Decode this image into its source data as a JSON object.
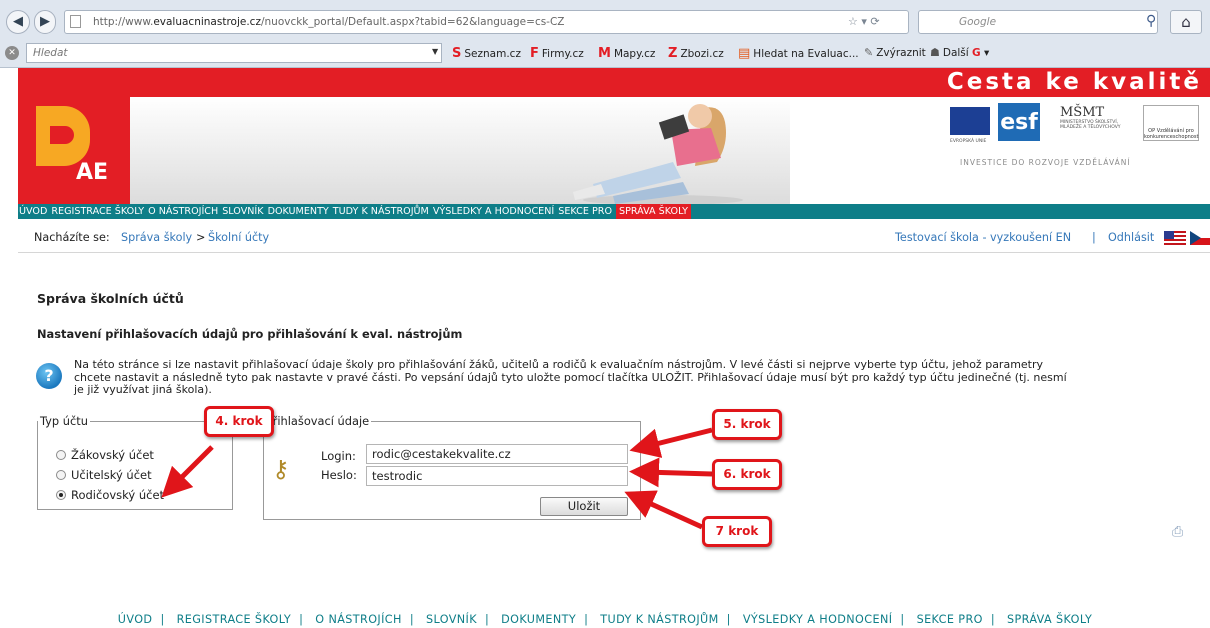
{
  "browser": {
    "url_prefix": "http://www.",
    "url_host": "evaluacninastroje.cz",
    "url_path": "/nuovckk_portal/Default.aspx?tabid=62&language=cs-CZ",
    "search_placeholder": "Google",
    "toolbar_search_placeholder": "Hledat",
    "bookmarks": [
      "Seznam.cz",
      "Firmy.cz",
      "Mapy.cz",
      "Zbozi.cz",
      "Hledat na Evaluac...",
      "Zvýraznit",
      "Další"
    ]
  },
  "banner": {
    "brand_title": "Cesta ke kvalitě",
    "logo_text": "AE",
    "slogan": "INVESTICE DO ROZVOJE VZDĚLÁVÁNÍ",
    "partner_logos": {
      "eu_caption": "EVROPSKÁ UNIE",
      "esf_text": "esf",
      "msmt_text": "MŠMT",
      "msmt_caption": "MINISTERSTVO ŠKOLSTVÍ, MLÁDEŽE A TĚLOVÝCHOVY",
      "op_caption": "OP Vzdělávání pro konkurenceschopnost"
    }
  },
  "menu": {
    "items": [
      "ÚVOD",
      "REGISTRACE ŠKOLY",
      "O NÁSTROJÍCH",
      "SLOVNÍK",
      "DOKUMENTY",
      "TUDY K NÁSTROJŮM",
      "VÝSLEDKY A HODNOCENÍ",
      "SEKCE PRO"
    ],
    "active": "SPRÁVA ŠKOLY"
  },
  "breadcrumb": {
    "label": "Nacházíte se:",
    "items": [
      "Správa školy",
      "Školní účty"
    ],
    "separator": ">"
  },
  "user": {
    "school": "Testovací škola - vyzkoušení EN",
    "separator": "|",
    "logout": "Odhlásit"
  },
  "content": {
    "title": "Správa školních účtů",
    "subtitle": "Nastavení přihlašovacích údajů pro přihlašování k eval. nástrojům",
    "info_line1": "Na této stránce si lze nastavit přihlašovací údaje školy pro přihlašování žáků, učitelů a rodičů k evaluačním nástrojům. V levé části si nejprve vyberte typ účtu, jehož parametry",
    "info_line2": "chcete nastavit a následně tyto pak nastavte v pravé části. Po vepsání údajů tyto uložte pomocí tlačítka ULOŽIT. Přihlašovací údaje musí být pro každý typ účtu jedinečné (tj. nesmí",
    "info_line3": "je již využívat jiná škola)."
  },
  "account_type": {
    "legend": "Typ účtu",
    "options": [
      "Žákovský účet",
      "Učitelský účet",
      "Rodičovský účet"
    ],
    "selected": "Rodičovský účet"
  },
  "login_form": {
    "legend": "Přihlašovací údaje",
    "login_label": "Login:",
    "login_value": "rodic@cestakekvalite.cz",
    "password_label": "Heslo:",
    "password_value": "testrodic",
    "save_label": "Uložit"
  },
  "callouts": {
    "step4": "4. krok",
    "step5": "5. krok",
    "step6": "6. krok",
    "step7": "7 krok"
  },
  "footer": {
    "items": [
      "ÚVOD",
      "REGISTRACE ŠKOLY",
      "O NÁSTROJÍCH",
      "SLOVNÍK",
      "DOKUMENTY",
      "TUDY K NÁSTROJŮM",
      "VÝSLEDKY A HODNOCENÍ",
      "SEKCE PRO",
      "SPRÁVA ŠKOLY"
    ],
    "separator": "|"
  },
  "colors": {
    "brand_red": "#e31e25",
    "menu_teal": "#0e7e88",
    "link_blue": "#3678b9",
    "callout_red": "#e0151a"
  }
}
